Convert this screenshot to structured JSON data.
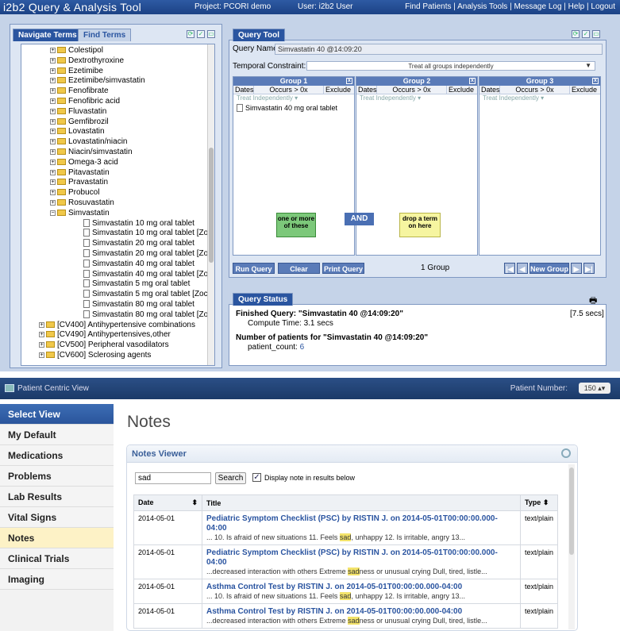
{
  "i2b2": {
    "app_title": "i2b2 Query & Analysis Tool",
    "project": "Project: PCORI demo",
    "user": "User: i2b2 User",
    "links": [
      "Find Patients",
      "Analysis Tools",
      "Message Log",
      "Help",
      "Logout"
    ],
    "left_tabs": [
      "Navigate Terms",
      "Find Terms"
    ],
    "tree": [
      {
        "label": "Colestipol",
        "kind": "folder",
        "indent": 1
      },
      {
        "label": "Dextrothyroxine",
        "kind": "folder",
        "indent": 1
      },
      {
        "label": "Ezetimibe",
        "kind": "folder",
        "indent": 1
      },
      {
        "label": "Ezetimibe/simvastatin",
        "kind": "folder",
        "indent": 1
      },
      {
        "label": "Fenofibrate",
        "kind": "folder",
        "indent": 1
      },
      {
        "label": "Fenofibric acid",
        "kind": "folder",
        "indent": 1
      },
      {
        "label": "Fluvastatin",
        "kind": "folder",
        "indent": 1
      },
      {
        "label": "Gemfibrozil",
        "kind": "folder",
        "indent": 1
      },
      {
        "label": "Lovastatin",
        "kind": "folder",
        "indent": 1
      },
      {
        "label": "Lovastatin/niacin",
        "kind": "folder",
        "indent": 1
      },
      {
        "label": "Niacin/simvastatin",
        "kind": "folder",
        "indent": 1
      },
      {
        "label": "Omega-3 acid",
        "kind": "folder",
        "indent": 1
      },
      {
        "label": "Pitavastatin",
        "kind": "folder",
        "indent": 1
      },
      {
        "label": "Pravastatin",
        "kind": "folder",
        "indent": 1
      },
      {
        "label": "Probucol",
        "kind": "folder",
        "indent": 1
      },
      {
        "label": "Rosuvastatin",
        "kind": "folder",
        "indent": 1
      },
      {
        "label": "Simvastatin",
        "kind": "folder-open",
        "indent": 1
      },
      {
        "label": "Simvastatin 10 mg oral tablet",
        "kind": "leaf",
        "indent": 2
      },
      {
        "label": "Simvastatin 10 mg oral tablet [Zocor]",
        "kind": "leaf",
        "indent": 2
      },
      {
        "label": "Simvastatin 20 mg oral tablet",
        "kind": "leaf",
        "indent": 2
      },
      {
        "label": "Simvastatin 20 mg oral tablet [Zocor]",
        "kind": "leaf",
        "indent": 2
      },
      {
        "label": "Simvastatin 40 mg oral tablet",
        "kind": "leaf",
        "indent": 2
      },
      {
        "label": "Simvastatin 40 mg oral tablet [Zocor]",
        "kind": "leaf",
        "indent": 2
      },
      {
        "label": "Simvastatin 5 mg oral tablet",
        "kind": "leaf",
        "indent": 2
      },
      {
        "label": "Simvastatin 5 mg oral tablet [Zocor]",
        "kind": "leaf",
        "indent": 2
      },
      {
        "label": "Simvastatin 80 mg oral tablet",
        "kind": "leaf",
        "indent": 2
      },
      {
        "label": "Simvastatin 80 mg oral tablet [Zocor]",
        "kind": "leaf",
        "indent": 2
      },
      {
        "label": "[CV400] Antihypertensive combinations",
        "kind": "folder",
        "indent": 0
      },
      {
        "label": "[CV490] Antihypertensives,other",
        "kind": "folder",
        "indent": 0
      },
      {
        "label": "[CV500] Peripheral vasodilators",
        "kind": "folder",
        "indent": 0
      },
      {
        "label": "[CV600] Sclerosing agents",
        "kind": "folder",
        "indent": 0
      }
    ],
    "query_tool": {
      "tab": "Query Tool",
      "name_label": "Query Name:",
      "name_value": "Simvastatin 40 @14:09:20",
      "temporal_label": "Temporal Constraint:",
      "temporal_value": "Treat all groups independently",
      "groups": [
        {
          "title": "Group 1",
          "item": "Simvastatin 40 mg oral tablet"
        },
        {
          "title": "Group 2",
          "item": ""
        },
        {
          "title": "Group 3",
          "item": ""
        }
      ],
      "group_cols": [
        "Dates",
        "Occurs > 0x",
        "Exclude"
      ],
      "group_sub": "Treat Independently",
      "hint_left": "one or more of these",
      "hint_and": "AND",
      "hint_right": "drop a term on here",
      "buttons": [
        "Run Query",
        "Clear",
        "Print Query"
      ],
      "group_count": "1 Group",
      "new_group": "New Group"
    },
    "query_status": {
      "tab": "Query Status",
      "finished": "Finished Query: \"Simvastatin 40 @14:09:20\"",
      "secs": "[7.5 secs]",
      "compute": "Compute Time: 3.1 secs",
      "npatients": "Number of patients for \"Simvastatin 40 @14:09:20\"",
      "count_label": "patient_count:",
      "count_value": "6"
    }
  },
  "pcv": {
    "title": "Patient Centric View",
    "patient_number_label": "Patient Number:",
    "patient_number": "150",
    "sidebar": [
      "Select View",
      "My Default",
      "Medications",
      "Problems",
      "Lab Results",
      "Vital Signs",
      "Notes",
      "Clinical Trials",
      "Imaging"
    ],
    "page_title": "Notes",
    "viewer_title": "Notes Viewer",
    "search_value": "sad",
    "search_button": "Search",
    "display_label": "Display note in results below",
    "columns": [
      "Date",
      "Title",
      "Type"
    ],
    "rows": [
      {
        "date": "2014-05-01",
        "title": "Pediatric Symptom Checklist (PSC) by                    RISTIN J. on 2014-05-01T00:00:00.000-04:00",
        "snip_pre": "... 10. Is afraid of new situations 11. Feels ",
        "snip_hl": "sad",
        "snip_post": ", unhappy 12. Is irritable, angry 13...",
        "type": "text/plain"
      },
      {
        "date": "2014-05-01",
        "title": "Pediatric Symptom Checklist (PSC) by                    RISTIN J. on 2014-05-01T00:00:00.000-04:00",
        "snip_pre": "...decreased interaction with others Extreme ",
        "snip_hl": "sad",
        "snip_post": "ness or unusual crying Dull, tired, listle...",
        "type": "text/plain"
      },
      {
        "date": "2014-05-01",
        "title": "Asthma Control Test by                    RISTIN J. on 2014-05-01T00:00:00.000-04:00",
        "snip_pre": "... 10. Is afraid of new situations 11. Feels ",
        "snip_hl": "sad",
        "snip_post": ", unhappy 12. Is irritable, angry 13...",
        "type": "text/plain"
      },
      {
        "date": "2014-05-01",
        "title": "Asthma Control Test by                    RISTIN J. on 2014-05-01T00:00:00.000-04:00",
        "snip_pre": "...decreased interaction with others Extreme ",
        "snip_hl": "sad",
        "snip_post": "ness or unusual crying Dull, tired, listle...",
        "type": "text/plain"
      }
    ]
  }
}
